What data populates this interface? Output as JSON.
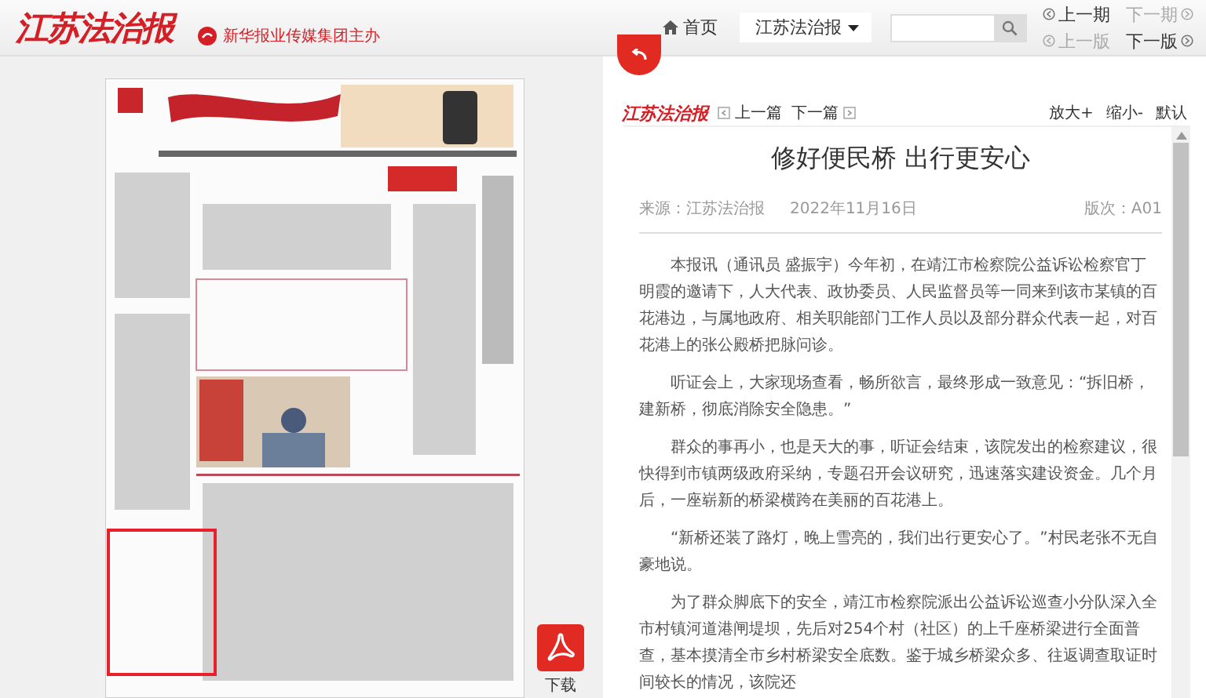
{
  "header": {
    "logo": "江苏法治报",
    "publisher": "新华报业传媒集团主办",
    "home": "首页",
    "paper_select": "江苏法治报",
    "issue_nav": [
      {
        "label": "上一期",
        "kind": "prev",
        "disabled": false
      },
      {
        "label": "下一期",
        "kind": "next",
        "disabled": true
      },
      {
        "label": "上一版",
        "kind": "prev",
        "disabled": true
      },
      {
        "label": "下一版",
        "kind": "next",
        "disabled": false
      }
    ]
  },
  "page_view": {
    "kind": "picture",
    "download_label": "下载"
  },
  "article": {
    "logo": "江苏法治报",
    "nav": [
      {
        "label": "上一篇",
        "kind": "prev"
      },
      {
        "label": "下一篇",
        "kind": "next"
      }
    ],
    "zoom": [
      "放大+",
      "缩小-",
      "默认"
    ],
    "title": "修好便民桥 出行更安心",
    "source": "来源：江苏法治报",
    "date": "2022年11月16日",
    "edition": "版次：A01",
    "paragraphs": [
      "本报讯（通讯员 盛振宇）今年初，在靖江市检察院公益诉讼检察官丁明霞的邀请下，人大代表、政协委员、人民监督员等一同来到该市某镇的百花港边，与属地政府、相关职能部门工作人员以及部分群众代表一起，对百花港上的张公殿桥把脉问诊。",
      "听证会上，大家现场查看，畅所欲言，最终形成一致意见：“拆旧桥，建新桥，彻底消除安全隐患。”",
      "群众的事再小，也是天大的事，听证会结束，该院发出的检察建议，很快得到市镇两级政府采纳，专题召开会议研究，迅速落实建设资金。几个月后，一座崭新的桥梁横跨在美丽的百花港上。",
      "“新桥还装了路灯，晚上雪亮的，我们出行更安心了。”村民老张不无自豪地说。",
      "为了群众脚底下的安全，靖江市检察院派出公益诉讼巡查小分队深入全市村镇河道港闸堤坝，先后对254个村（社区）的上千座桥梁进行全面普查，基本摸清全市乡村桥梁安全底数。鉴于城乡桥梁众多、往返调查取证时间较长的情况，该院还"
    ]
  }
}
